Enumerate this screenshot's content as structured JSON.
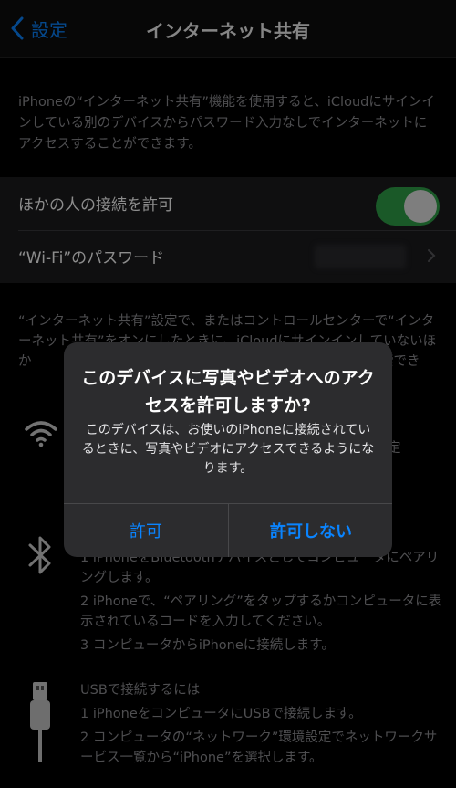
{
  "nav": {
    "back_label": "設定",
    "title": "インターネット共有"
  },
  "intro_text": "iPhoneの“インターネット共有”機能を使用すると、iCloudにサインインしている別のデバイスからパスワード入力なしでインターネットにアクセスすることができます。",
  "settings": {
    "allow_others_label": "ほかの人の接続を許可",
    "allow_others_on": true,
    "wifi_password_label": "“Wi-Fi”のパスワード"
  },
  "info_text": "“インターネット共有”設定で、またはコントロールセンターで“インターネット共有”をオンにしたときに、iCloudにサインインしていないほか　　　　　　　　　　　　　　　　　　　　　　one”を検索でき",
  "wifi_section": {
    "icon": "wifi-icon",
    "partial_text": "定"
  },
  "bluetooth_section": {
    "icon": "bluetooth-icon",
    "steps": [
      "1 iPhoneをBluetoothデバイスとしてコンピュータにペアリングします。",
      "2 iPhoneで、“ペアリング”をタップするかコンピュータに表示されているコードを入力してください。",
      "3 コンピュータからiPhoneに接続します。"
    ]
  },
  "usb_section": {
    "icon": "usb-cable-icon",
    "heading": "USBで接続するには",
    "steps": [
      "1 iPhoneをコンピュータにUSBで接続します。",
      "2 コンピュータの“ネットワーク”環境設定でネットワークサービス一覧から“iPhone”を選択します。"
    ]
  },
  "alert": {
    "title": "このデバイスに写真やビデオへのアクセスを許可しますか?",
    "message": "このデバイスは、お使いのiPhoneに接続されているときに、写真やビデオにアクセスできるようになります。",
    "allow_label": "許可",
    "deny_label": "許可しない"
  },
  "colors": {
    "accent": "#0a84ff",
    "toggle_on": "#31a34a",
    "background": "#000000",
    "cell": "#1c1c1e",
    "alert_bg": "#2c2c2e"
  }
}
